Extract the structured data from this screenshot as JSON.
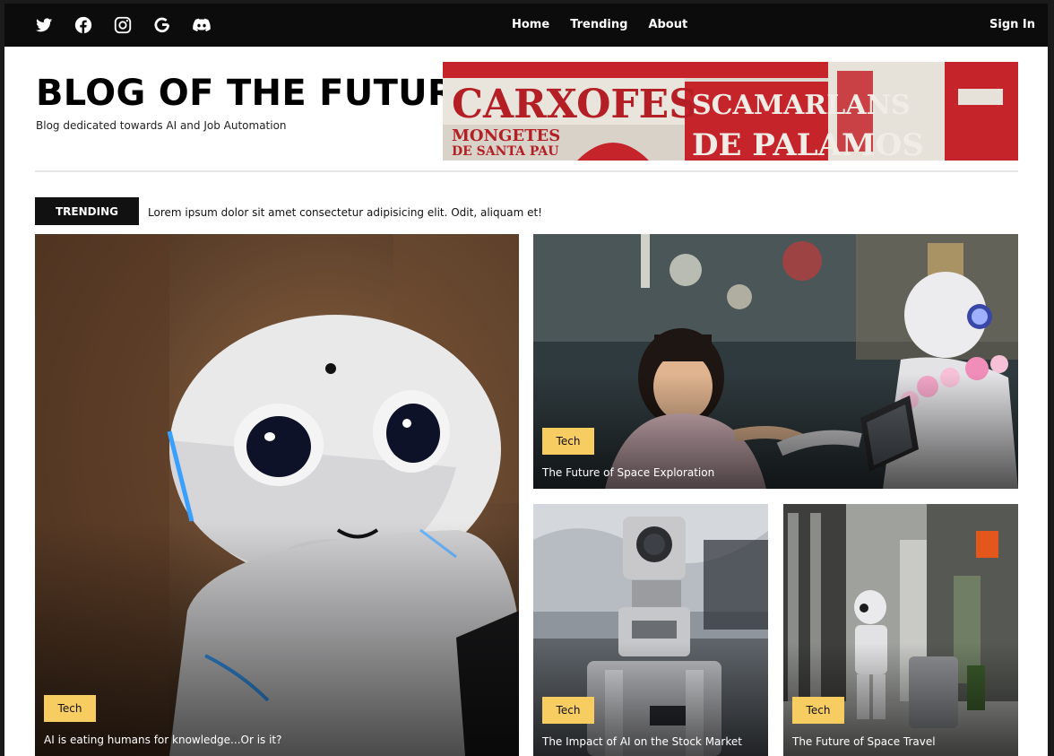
{
  "nav": {
    "social": [
      "twitter-icon",
      "facebook-icon",
      "instagram-icon",
      "google-icon",
      "discord-icon"
    ],
    "menu": [
      "Home",
      "Trending",
      "About"
    ],
    "sign_in": "Sign In"
  },
  "header": {
    "title": "BLOG OF THE FUTURE",
    "subtitle": "Blog dedicated towards AI and Job Automation",
    "banner_text": [
      "CARXOFES",
      "SCAMARLANS",
      "MONGETES",
      "DE SANTA PAU",
      "DE PALAMOS"
    ]
  },
  "trending": {
    "label": "TRENDING",
    "text": "Lorem ipsum dolor sit amet consectetur adipisicing elit. Odit, aliquam et!"
  },
  "cards": [
    {
      "tag": "Tech",
      "title": "AI is eating humans for knowledge...Or is it?"
    },
    {
      "tag": "Tech",
      "title": "The Future of Space Exploration"
    },
    {
      "tag": "Tech",
      "title": "The Impact of AI on the Stock Market"
    },
    {
      "tag": "Tech",
      "title": "The Future of Space Travel"
    }
  ],
  "colors": {
    "nav_bg": "#0c0c0c",
    "tag_bg": "#f7cd62",
    "trend_label_bg": "#111111"
  }
}
